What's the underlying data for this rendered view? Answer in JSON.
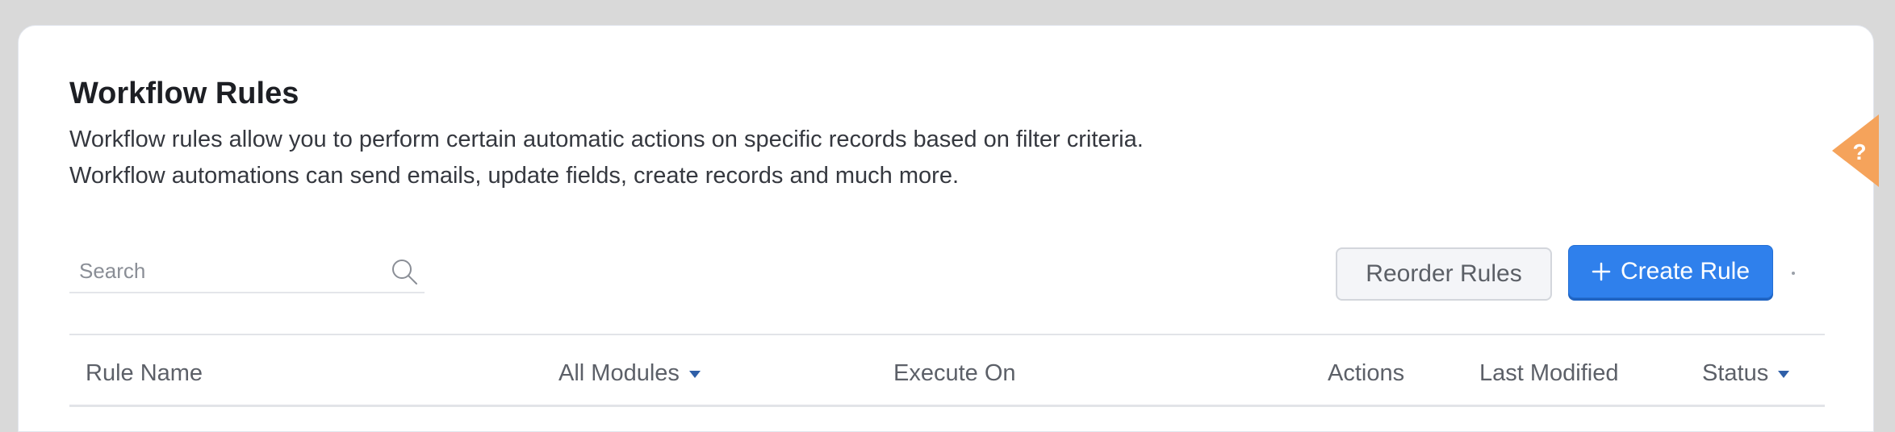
{
  "page": {
    "title": "Workflow Rules",
    "description_line1": "Workflow rules allow you to perform certain automatic actions on specific records based on filter criteria.",
    "description_line2": "Workflow automations can send emails, update fields, create records and much more."
  },
  "search": {
    "placeholder": "Search",
    "value": "",
    "icon": "search-icon"
  },
  "toolbar": {
    "reorder_label": "Reorder Rules",
    "create_label": "Create Rule",
    "create_icon": "plus-icon"
  },
  "table": {
    "columns": [
      {
        "label": "Rule Name",
        "has_dropdown": false
      },
      {
        "label": "All Modules",
        "has_dropdown": true
      },
      {
        "label": "Execute On",
        "has_dropdown": false
      },
      {
        "label": "Actions",
        "has_dropdown": false
      },
      {
        "label": "Last Modified",
        "has_dropdown": false
      },
      {
        "label": "Status",
        "has_dropdown": true
      }
    ]
  },
  "help": {
    "glyph": "?",
    "icon": "help-icon"
  },
  "colors": {
    "primary": "#2f80ec",
    "help_accent": "#f5a35b",
    "dropdown_caret": "#2f5fa8",
    "title_text": "#1d1f24",
    "header_text": "#5c6068"
  }
}
